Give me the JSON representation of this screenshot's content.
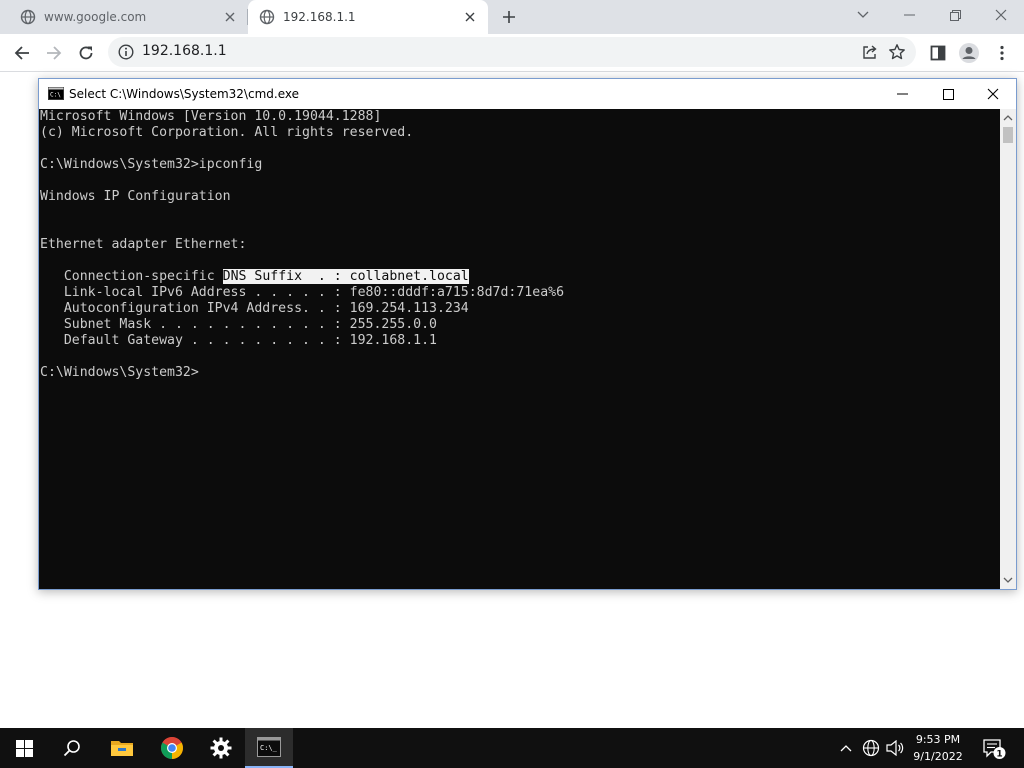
{
  "browser": {
    "tabs": [
      {
        "title": "www.google.com",
        "active": false
      },
      {
        "title": "192.168.1.1",
        "active": true
      }
    ],
    "address": "192.168.1.1"
  },
  "cmd": {
    "title": "Select C:\\Windows\\System32\\cmd.exe",
    "lines": [
      {
        "pre": "Microsoft Windows [Version 10.0.19044.1288]",
        "sel": "",
        "post": ""
      },
      {
        "pre": "(c) Microsoft Corporation. All rights reserved.",
        "sel": "",
        "post": ""
      },
      {
        "pre": "",
        "sel": "",
        "post": ""
      },
      {
        "pre": "C:\\Windows\\System32>ipconfig",
        "sel": "",
        "post": ""
      },
      {
        "pre": "",
        "sel": "",
        "post": ""
      },
      {
        "pre": "Windows IP Configuration",
        "sel": "",
        "post": ""
      },
      {
        "pre": "",
        "sel": "",
        "post": ""
      },
      {
        "pre": "",
        "sel": "",
        "post": ""
      },
      {
        "pre": "Ethernet adapter Ethernet:",
        "sel": "",
        "post": ""
      },
      {
        "pre": "",
        "sel": "",
        "post": ""
      },
      {
        "pre": "   Connection-specific ",
        "sel": "DNS Suffix  . : collabnet.local",
        "post": ""
      },
      {
        "pre": "   Link-local IPv6 Address . . . . . : fe80::dddf:a715:8d7d:71ea%6",
        "sel": "",
        "post": ""
      },
      {
        "pre": "   Autoconfiguration IPv4 Address. . : 169.254.113.234",
        "sel": "",
        "post": ""
      },
      {
        "pre": "   Subnet Mask . . . . . . . . . . . : 255.255.0.0",
        "sel": "",
        "post": ""
      },
      {
        "pre": "   Default Gateway . . . . . . . . . : 192.168.1.1",
        "sel": "",
        "post": ""
      },
      {
        "pre": "",
        "sel": "",
        "post": ""
      },
      {
        "pre": "C:\\Windows\\System32>",
        "sel": "",
        "post": ""
      }
    ]
  },
  "taskbar": {
    "pinned": [
      "windows-start",
      "search",
      "file-explorer",
      "chrome",
      "settings",
      "command-prompt"
    ],
    "active": "command-prompt",
    "clock": {
      "time": "9:53 PM",
      "date": "9/1/2022"
    },
    "notification_count": "1"
  }
}
